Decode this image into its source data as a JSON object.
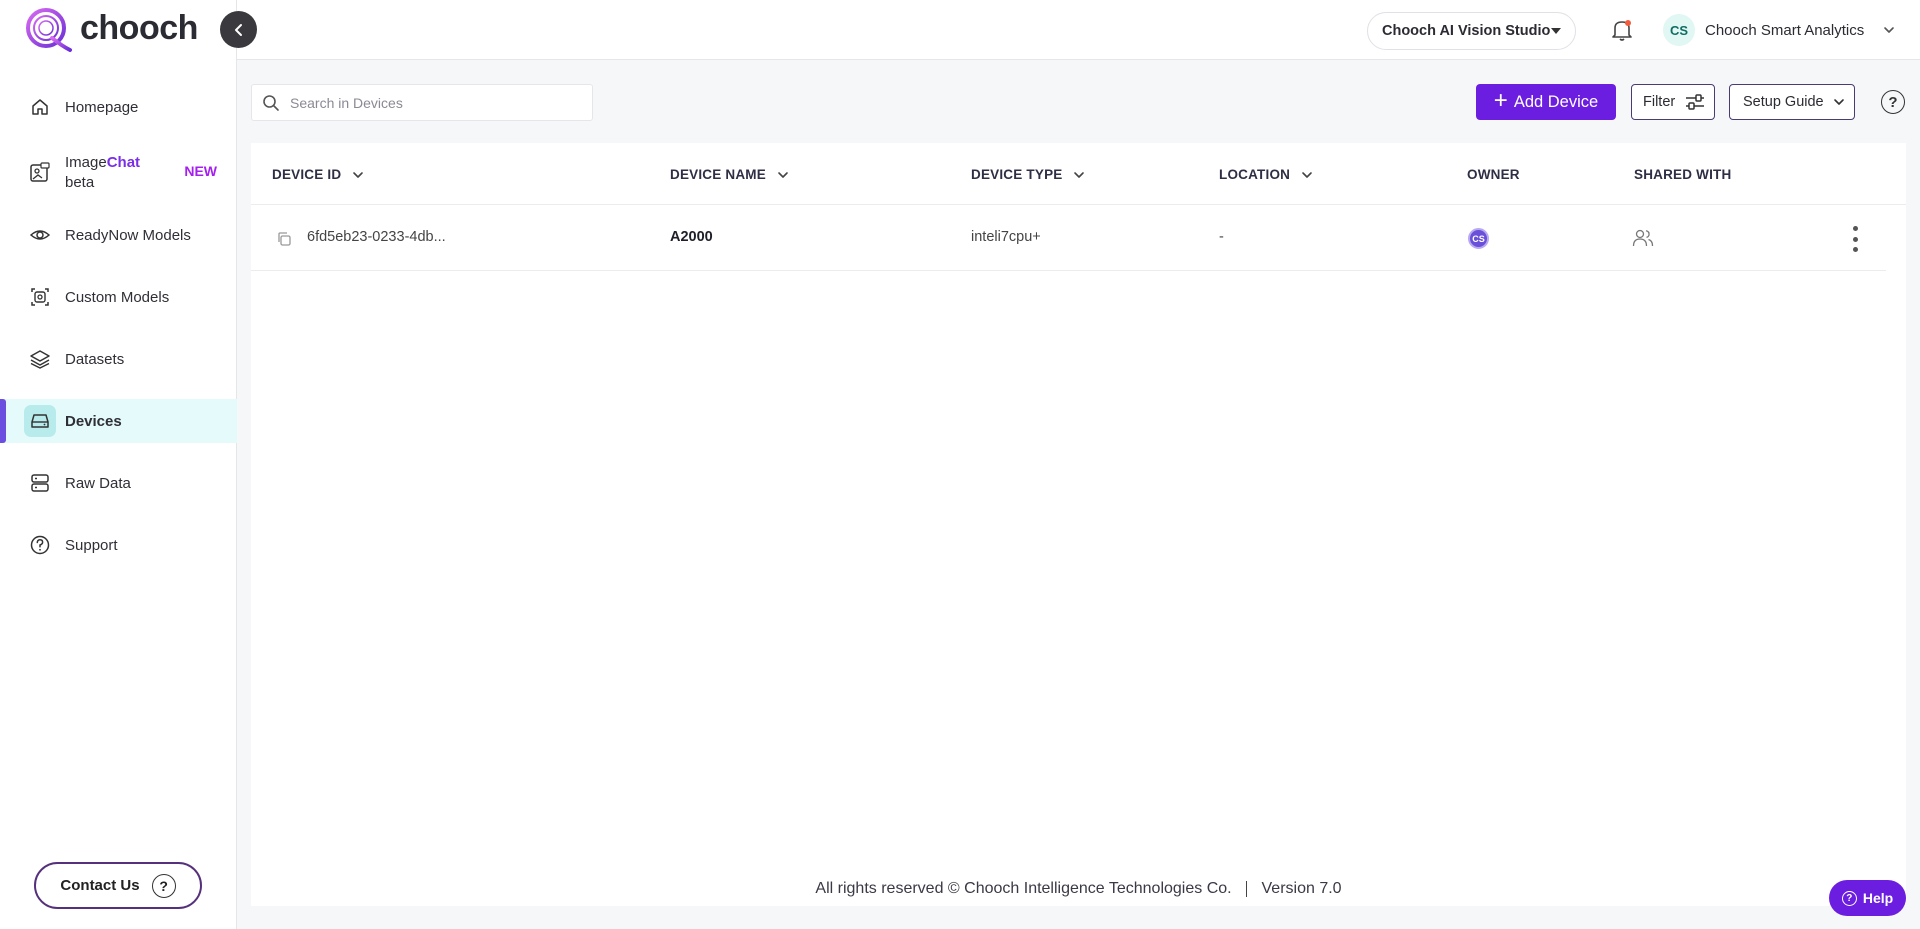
{
  "brand": {
    "name": "chooch"
  },
  "sidebar": {
    "items": [
      {
        "label": "Homepage",
        "icon": "home-icon"
      },
      {
        "label_prefix": "Image",
        "label_highlight": "Chat",
        "sublabel": "beta",
        "badge": "NEW",
        "icon": "image-chat-icon"
      },
      {
        "label": "ReadyNow Models",
        "icon": "eye-icon"
      },
      {
        "label": "Custom Models",
        "icon": "custom-model-icon"
      },
      {
        "label": "Datasets",
        "icon": "layers-icon"
      },
      {
        "label": "Devices",
        "icon": "device-icon",
        "active": true
      },
      {
        "label": "Raw Data",
        "icon": "server-icon"
      },
      {
        "label": "Support",
        "icon": "question-icon"
      }
    ],
    "contact_label": "Contact Us"
  },
  "header": {
    "workspace": "Chooch AI Vision Studio",
    "account_initials": "CS",
    "account_name": "Chooch Smart Analytics"
  },
  "toolbar": {
    "search_placeholder": "Search in Devices",
    "add_device_label": "Add Device",
    "filter_label": "Filter",
    "setup_label": "Setup Guide",
    "help_glyph": "?"
  },
  "table": {
    "columns": [
      "DEVICE ID",
      "DEVICE NAME",
      "DEVICE TYPE",
      "LOCATION",
      "OWNER",
      "SHARED WITH"
    ],
    "rows": [
      {
        "device_id": "6fd5eb23-0233-4db...",
        "device_name": "A2000",
        "device_type": "inteli7cpu+",
        "location": "-",
        "owner_initials": "CS"
      }
    ]
  },
  "footer": {
    "copyright": "All rights reserved © Chooch Intelligence Technologies Co.",
    "version": "Version 7.0"
  },
  "help_fab": {
    "label": "Help"
  },
  "colors": {
    "accent": "#6b1ee0",
    "active_bg": "#e5fafa",
    "active_icon_bg": "#b8ecec"
  }
}
